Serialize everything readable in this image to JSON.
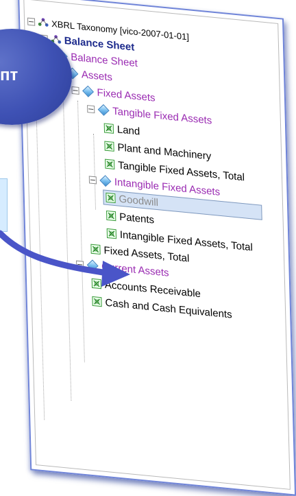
{
  "bubble": {
    "text": "пт"
  },
  "tree": {
    "items": [
      {
        "label": "XBRL Taxonomy [vico-2007-01-01]",
        "icon": "taxonomy-icon",
        "level": 0
      },
      {
        "label": "Balance Sheet",
        "icon": "taxonomy-icon",
        "level": 1,
        "bold": true
      },
      {
        "label": "Balance Sheet",
        "icon": "diamond-icon",
        "level": 2
      },
      {
        "label": "Assets",
        "icon": "diamond-icon",
        "level": 3
      },
      {
        "label": "Fixed Assets",
        "icon": "diamond-icon",
        "level": 4
      },
      {
        "label": "Tangible Fixed Assets",
        "icon": "diamond-icon",
        "level": 5
      },
      {
        "label": "Land",
        "icon": "element-icon",
        "level": 6
      },
      {
        "label": "Plant and Machinery",
        "icon": "element-icon",
        "level": 6
      },
      {
        "label": "Tangible Fixed Assets, Total",
        "icon": "element-icon",
        "level": 6
      },
      {
        "label": "Intangible Fixed Assets",
        "icon": "diamond-icon",
        "level": 5
      },
      {
        "label": "Goodwill",
        "icon": "element-icon",
        "level": 6,
        "selected": true
      },
      {
        "label": "Patents",
        "icon": "element-icon",
        "level": 6
      },
      {
        "label": "Intangible Fixed Assets, Total",
        "icon": "element-icon",
        "level": 6
      },
      {
        "label": "Fixed Assets, Total",
        "icon": "element-icon",
        "level": 5
      },
      {
        "label": "Current Assets",
        "icon": "diamond-icon",
        "level": 4
      },
      {
        "label": "Accounts Receivable",
        "icon": "element-icon",
        "level": 5
      },
      {
        "label": "Cash and Cash Equivalents",
        "icon": "element-icon",
        "level": 5
      }
    ]
  },
  "colors": {
    "bubble": "#3e51b4",
    "arrow": "#4a55c8",
    "panel_border": "#6f84d8",
    "selection": "#d5e3f6",
    "concept_text": "#9a2bb2",
    "heading_text": "#1c2a8c"
  }
}
